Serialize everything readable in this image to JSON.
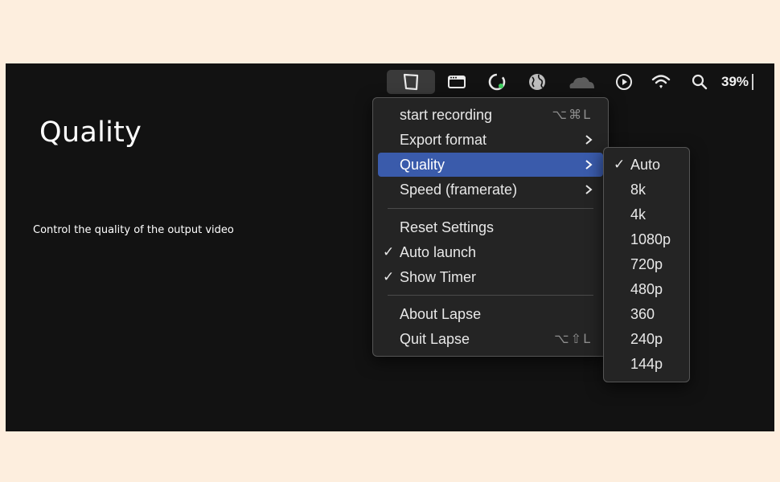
{
  "page": {
    "title": "Quality",
    "description": "Control the quality of the output video"
  },
  "menubar": {
    "icons": [
      "lapse-app-icon",
      "window-icon",
      "activity-ring-icon",
      "globe-icon",
      "cloudflare-icon",
      "play-circle-icon",
      "wifi-icon",
      "search-icon"
    ],
    "battery": "39%"
  },
  "main_menu": {
    "items": [
      {
        "label": "start recording",
        "shortcut": "⌥⌘L",
        "checked": false,
        "submenu": false
      },
      {
        "label": "Export format",
        "shortcut": "",
        "checked": false,
        "submenu": true
      },
      {
        "label": "Quality",
        "shortcut": "",
        "checked": false,
        "submenu": true,
        "selected": true
      },
      {
        "label": "Speed (framerate)",
        "shortcut": "",
        "checked": false,
        "submenu": true
      },
      {
        "label": "Reset Settings",
        "shortcut": "",
        "checked": false,
        "submenu": false
      },
      {
        "label": "Auto launch",
        "shortcut": "",
        "checked": true,
        "submenu": false
      },
      {
        "label": "Show Timer",
        "shortcut": "",
        "checked": true,
        "submenu": false
      },
      {
        "label": "About Lapse",
        "shortcut": "",
        "checked": false,
        "submenu": false
      },
      {
        "label": "Quit Lapse",
        "shortcut": "⌥⇧L",
        "checked": false,
        "submenu": false
      }
    ],
    "check_glyph": "✓"
  },
  "quality_submenu": {
    "items": [
      {
        "label": "Auto",
        "checked": true
      },
      {
        "label": "8k",
        "checked": false
      },
      {
        "label": "4k",
        "checked": false
      },
      {
        "label": "1080p",
        "checked": false
      },
      {
        "label": "720p",
        "checked": false
      },
      {
        "label": "480p",
        "checked": false
      },
      {
        "label": "360",
        "checked": false
      },
      {
        "label": "240p",
        "checked": false
      },
      {
        "label": "144p",
        "checked": false
      }
    ],
    "check_glyph": "✓"
  },
  "colors": {
    "page_bg": "#fdeede",
    "frame_bg": "#121212",
    "menu_bg": "#242424",
    "highlight": "#3a5bab"
  }
}
